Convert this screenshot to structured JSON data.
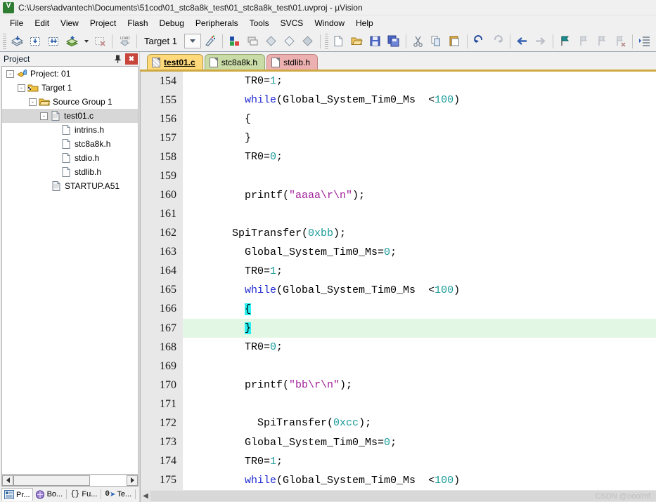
{
  "window": {
    "title": "C:\\Users\\advantech\\Documents\\51cod\\01_stc8a8k_test\\01_stc8a8k_test\\01.uvproj - µVision",
    "app_icon": "uvision-logo-icon"
  },
  "menubar": {
    "items": [
      {
        "label": "File"
      },
      {
        "label": "Edit"
      },
      {
        "label": "View"
      },
      {
        "label": "Project"
      },
      {
        "label": "Flash"
      },
      {
        "label": "Debug"
      },
      {
        "label": "Peripherals"
      },
      {
        "label": "Tools"
      },
      {
        "label": "SVCS"
      },
      {
        "label": "Window"
      },
      {
        "label": "Help"
      }
    ]
  },
  "toolbar": {
    "target_value": "Target 1",
    "buttons": [
      {
        "name": "build-icon"
      },
      {
        "name": "translate-icon"
      },
      {
        "name": "rebuild-icon"
      },
      {
        "name": "batch-build-icon"
      },
      {
        "name": "batch-build-dropdown-icon"
      },
      {
        "name": "stop-build-icon"
      },
      {
        "name": "download-icon"
      },
      {
        "name": "target-options-icon"
      },
      {
        "name": "manage-run-environment-icon"
      },
      {
        "name": "multi-project-icon"
      },
      {
        "name": "book-icon"
      },
      {
        "name": "component-icon"
      },
      {
        "name": "package-icon"
      },
      {
        "name": "new-file-icon"
      },
      {
        "name": "open-file-icon"
      },
      {
        "name": "save-icon"
      },
      {
        "name": "save-all-icon"
      },
      {
        "name": "cut-icon"
      },
      {
        "name": "copy-icon"
      },
      {
        "name": "paste-icon"
      },
      {
        "name": "undo-icon"
      },
      {
        "name": "redo-icon"
      },
      {
        "name": "navigate-back-icon"
      },
      {
        "name": "navigate-forward-icon"
      },
      {
        "name": "bookmark-toggle-icon"
      },
      {
        "name": "bookmark-prev-icon"
      },
      {
        "name": "bookmark-next-icon"
      },
      {
        "name": "bookmark-clear-icon"
      },
      {
        "name": "indent-icon"
      },
      {
        "name": "outdent-icon"
      }
    ]
  },
  "project_panel": {
    "title": "Project",
    "pin_label": "ƿ",
    "close_label": "✖",
    "tree": [
      {
        "label": "Project: 01",
        "depth": 0,
        "toggle": "-",
        "icon": "project-icon",
        "selected": false
      },
      {
        "label": "Target 1",
        "depth": 1,
        "toggle": "-",
        "icon": "target-folder-icon",
        "selected": false
      },
      {
        "label": "Source Group 1",
        "depth": 2,
        "toggle": "-",
        "icon": "folder-icon",
        "selected": false
      },
      {
        "label": "test01.c",
        "depth": 3,
        "toggle": "-",
        "icon": "c-file-icon",
        "selected": true
      },
      {
        "label": "intrins.h",
        "depth": 4,
        "toggle": "",
        "icon": "header-file-icon",
        "selected": false
      },
      {
        "label": "stc8a8k.h",
        "depth": 4,
        "toggle": "",
        "icon": "header-file-icon",
        "selected": false
      },
      {
        "label": "stdio.h",
        "depth": 4,
        "toggle": "",
        "icon": "header-file-icon",
        "selected": false
      },
      {
        "label": "stdlib.h",
        "depth": 4,
        "toggle": "",
        "icon": "header-file-icon",
        "selected": false
      },
      {
        "label": "STARTUP.A51",
        "depth": 3,
        "toggle": "",
        "icon": "asm-file-icon",
        "selected": false
      }
    ],
    "bottom_tabs": [
      {
        "label": "Pr...",
        "icon": "project-tab-icon",
        "active": true
      },
      {
        "label": "Bo...",
        "icon": "books-tab-icon",
        "active": false
      },
      {
        "label": "Fu...",
        "icon": "functions-tab-icon",
        "prefix": "{}",
        "active": false
      },
      {
        "label": "Te...",
        "icon": "templates-tab-icon",
        "prefix": "0",
        "active": false
      }
    ]
  },
  "editor": {
    "tabs": [
      {
        "label": "test01.c",
        "active": true,
        "color": "#ffd97a",
        "border": "#b59b4a",
        "icon": "c-file-icon"
      },
      {
        "label": "stc8a8k.h",
        "active": false,
        "color": "#c9dba6",
        "border": "#93a86f",
        "icon": "header-file-icon"
      },
      {
        "label": "stdlib.h",
        "active": false,
        "color": "#edb0b0",
        "border": "#c08282",
        "icon": "header-file-icon"
      }
    ],
    "first_visible_line": 154,
    "current_line": 167,
    "colors": {
      "keyword": "#1f29d0",
      "number": "#1a9a9a",
      "string": "#a01f9a",
      "brace_highlight": "#28f0f0",
      "current_line_bg": "#e2f7e4",
      "gutter_bg": "#e8e8e8"
    },
    "lines": [
      {
        "n": 154,
        "tokens": [
          {
            "t": "        TR0=",
            "c": ""
          },
          {
            "t": "1",
            "c": "num"
          },
          {
            "t": ";",
            "c": ""
          }
        ]
      },
      {
        "n": 155,
        "tokens": [
          {
            "t": "        ",
            "c": ""
          },
          {
            "t": "while",
            "c": "kw"
          },
          {
            "t": "(Global_System_Tim0_Ms  <",
            "c": ""
          },
          {
            "t": "100",
            "c": "num"
          },
          {
            "t": ")",
            "c": ""
          }
        ]
      },
      {
        "n": 156,
        "tokens": [
          {
            "t": "        {",
            "c": ""
          }
        ]
      },
      {
        "n": 157,
        "tokens": [
          {
            "t": "        }",
            "c": ""
          }
        ]
      },
      {
        "n": 158,
        "tokens": [
          {
            "t": "        TR0=",
            "c": ""
          },
          {
            "t": "0",
            "c": "num"
          },
          {
            "t": ";",
            "c": ""
          }
        ]
      },
      {
        "n": 159,
        "tokens": [
          {
            "t": "",
            "c": ""
          }
        ]
      },
      {
        "n": 160,
        "tokens": [
          {
            "t": "        printf(",
            "c": ""
          },
          {
            "t": "\"aaaa\\r\\n\"",
            "c": "str"
          },
          {
            "t": ");",
            "c": ""
          }
        ]
      },
      {
        "n": 161,
        "tokens": [
          {
            "t": "",
            "c": ""
          }
        ]
      },
      {
        "n": 162,
        "tokens": [
          {
            "t": "      SpiTransfer(",
            "c": ""
          },
          {
            "t": "0xbb",
            "c": "num"
          },
          {
            "t": ");",
            "c": ""
          }
        ]
      },
      {
        "n": 163,
        "tokens": [
          {
            "t": "        Global_System_Tim0_Ms=",
            "c": ""
          },
          {
            "t": "0",
            "c": "num"
          },
          {
            "t": ";",
            "c": ""
          }
        ]
      },
      {
        "n": 164,
        "tokens": [
          {
            "t": "        TR0=",
            "c": ""
          },
          {
            "t": "1",
            "c": "num"
          },
          {
            "t": ";",
            "c": ""
          }
        ]
      },
      {
        "n": 165,
        "tokens": [
          {
            "t": "        ",
            "c": ""
          },
          {
            "t": "while",
            "c": "kw"
          },
          {
            "t": "(Global_System_Tim0_Ms  <",
            "c": ""
          },
          {
            "t": "100",
            "c": "num"
          },
          {
            "t": ")",
            "c": ""
          }
        ]
      },
      {
        "n": 166,
        "tokens": [
          {
            "t": "        ",
            "c": ""
          },
          {
            "t": "{",
            "c": "brace"
          }
        ]
      },
      {
        "n": 167,
        "tokens": [
          {
            "t": "        ",
            "c": ""
          },
          {
            "t": "}",
            "c": "brace"
          }
        ]
      },
      {
        "n": 168,
        "tokens": [
          {
            "t": "        TR0=",
            "c": ""
          },
          {
            "t": "0",
            "c": "num"
          },
          {
            "t": ";",
            "c": ""
          }
        ]
      },
      {
        "n": 169,
        "tokens": [
          {
            "t": "",
            "c": ""
          }
        ]
      },
      {
        "n": 170,
        "tokens": [
          {
            "t": "        printf(",
            "c": ""
          },
          {
            "t": "\"bb\\r\\n\"",
            "c": "str"
          },
          {
            "t": ");",
            "c": ""
          }
        ]
      },
      {
        "n": 171,
        "tokens": [
          {
            "t": "",
            "c": ""
          }
        ]
      },
      {
        "n": 172,
        "tokens": [
          {
            "t": "          SpiTransfer(",
            "c": ""
          },
          {
            "t": "0xcc",
            "c": "num"
          },
          {
            "t": ");",
            "c": ""
          }
        ]
      },
      {
        "n": 173,
        "tokens": [
          {
            "t": "        Global_System_Tim0_Ms=",
            "c": ""
          },
          {
            "t": "0",
            "c": "num"
          },
          {
            "t": ";",
            "c": ""
          }
        ]
      },
      {
        "n": 174,
        "tokens": [
          {
            "t": "        TR0=",
            "c": ""
          },
          {
            "t": "1",
            "c": "num"
          },
          {
            "t": ";",
            "c": ""
          }
        ]
      },
      {
        "n": 175,
        "tokens": [
          {
            "t": "        ",
            "c": ""
          },
          {
            "t": "while",
            "c": "kw"
          },
          {
            "t": "(Global_System_Tim0_Ms  <",
            "c": ""
          },
          {
            "t": "100",
            "c": "num"
          },
          {
            "t": ")",
            "c": ""
          }
        ]
      }
    ]
  },
  "watermark": {
    "text": "CSDN @ooolmf"
  }
}
